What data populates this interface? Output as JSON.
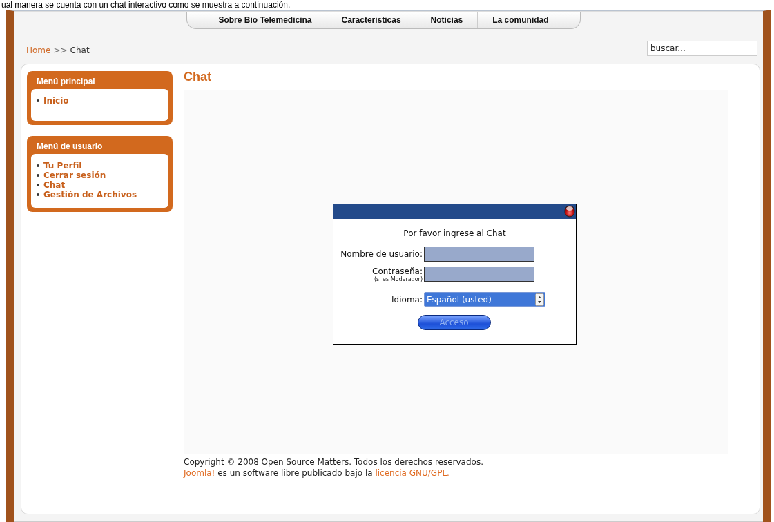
{
  "document_caption": "ual manera se cuenta con un chat interactivo como se muestra a continuación.",
  "nav": [
    {
      "label": "Sobre Bio Telemedicina"
    },
    {
      "label": "Características"
    },
    {
      "label": "Noticias"
    },
    {
      "label": "La comunidad"
    }
  ],
  "breadcrumb": {
    "home": "Home",
    "separator": ">>",
    "current": "Chat"
  },
  "search": {
    "value": "buscar..."
  },
  "modules": [
    {
      "title": "Menú principal",
      "items": [
        "Inicio"
      ]
    },
    {
      "title": "Menú de usuario",
      "items": [
        "Tu Perfil",
        "Cerrar sesión",
        "Chat",
        "Gestión de Archivos"
      ]
    }
  ],
  "content": {
    "title": "Chat"
  },
  "login": {
    "heading": "Por favor ingrese al Chat",
    "username_label": "Nombre de usuario:",
    "password_label": "Contraseña:",
    "password_note": "(si es Moderador)",
    "language_label": "Idioma:",
    "language_value": "Español (usted)",
    "submit": "Acceso"
  },
  "footer": {
    "copyright": "Copyright © 2008 Open Source Matters. Todos los derechos reservados.",
    "link": "Joomla!",
    "text": " es un software libre publicado bajo la ",
    "license": "licencia GNU/GPL."
  }
}
